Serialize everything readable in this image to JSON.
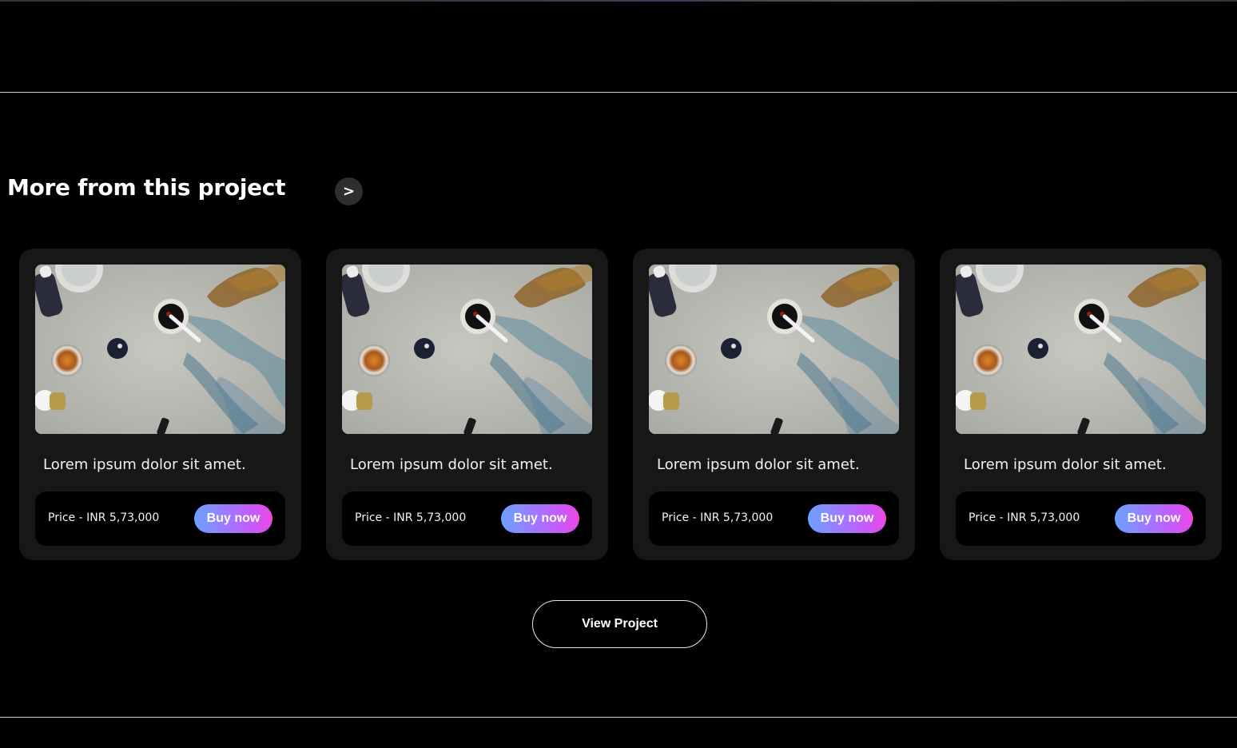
{
  "section": {
    "title": "More from this project",
    "next_label": ">"
  },
  "cards": [
    {
      "title": "Lorem ipsum dolor sit amet.",
      "price": "Price - INR 5,73,000",
      "buy_label": "Buy now",
      "image": "paint-table-photo"
    },
    {
      "title": "Lorem ipsum dolor sit amet.",
      "price": "Price - INR 5,73,000",
      "buy_label": "Buy now",
      "image": "paint-table-photo"
    },
    {
      "title": "Lorem ipsum dolor sit amet.",
      "price": "Price - INR 5,73,000",
      "buy_label": "Buy now",
      "image": "paint-table-photo"
    },
    {
      "title": "Lorem ipsum dolor sit amet.",
      "price": "Price - INR 5,73,000",
      "buy_label": "Buy now",
      "image": "paint-table-photo"
    }
  ],
  "view_project_label": "View Project",
  "colors": {
    "background": "#000000",
    "card": "#171717",
    "buy_gradient_start": "#6aa3ff",
    "buy_gradient_end": "#ea49e0"
  }
}
